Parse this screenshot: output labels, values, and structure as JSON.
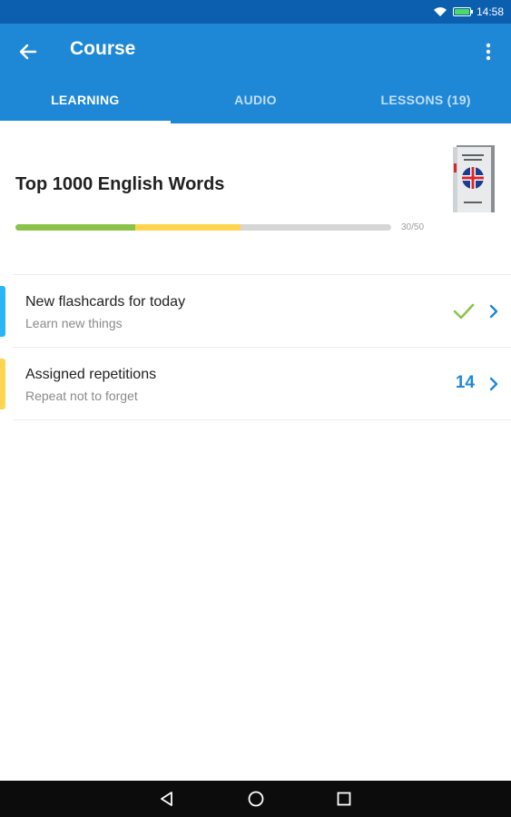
{
  "status_bar": {
    "time": "14:58",
    "wifi_icon": "wifi-icon",
    "battery_icon": "battery-icon",
    "battery_level": 1.0,
    "battery_color": "#4cd964"
  },
  "app_bar": {
    "title": "Course",
    "back_icon": "arrow-back-icon",
    "menu_icon": "more-vert-icon",
    "color": "#1e88d6"
  },
  "tabs": [
    {
      "label": "LEARNING",
      "active": true
    },
    {
      "label": "AUDIO",
      "active": false
    },
    {
      "label": "LESSONS (19)",
      "active": false
    }
  ],
  "course": {
    "name": "Top 1000 English Words",
    "progress_label": "30/50",
    "progress": {
      "green_fraction": 0.32,
      "yellow_fraction": 0.28
    },
    "cover_icon": "uk-flag-book-icon"
  },
  "rows": [
    {
      "title": "New flashcards for today",
      "subtitle": "Learn new things",
      "accent": "#29b6f6",
      "status_icon": "checkmark-icon",
      "status_color": "#8bc34a",
      "chevron_icon": "chevron-right-icon"
    },
    {
      "title": "Assigned repetitions",
      "subtitle": "Repeat not to forget",
      "accent": "#ffd54f",
      "count": "14",
      "chevron_icon": "chevron-right-icon"
    }
  ],
  "nav_bar": {
    "back_icon": "nav-back-icon",
    "home_icon": "nav-home-icon",
    "recents_icon": "nav-recents-icon"
  }
}
